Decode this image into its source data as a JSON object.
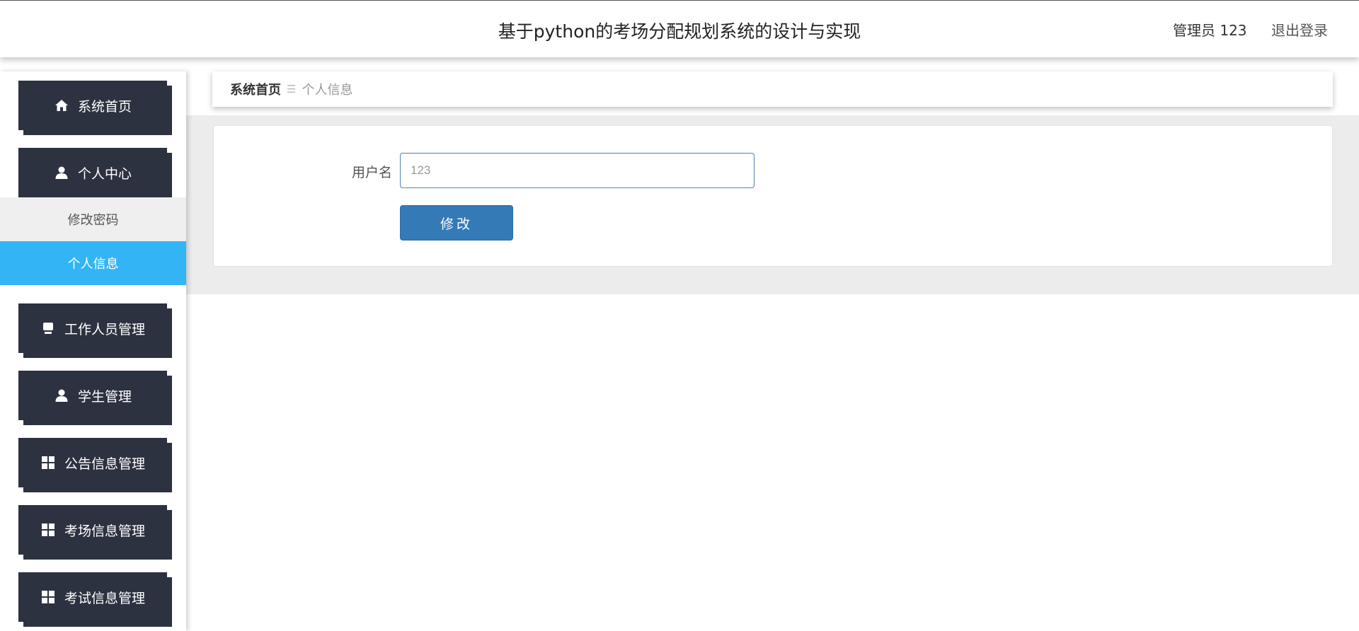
{
  "header": {
    "title": "基于python的考场分配规划系统的设计与实现",
    "user": "管理员 123",
    "logout": "退出登录"
  },
  "sidebar": {
    "home": {
      "label": "系统首页",
      "icon": "home-icon"
    },
    "personal_center": {
      "label": "个人中心",
      "icon": "user-icon"
    },
    "sub_items": [
      {
        "label": "修改密码"
      },
      {
        "label": "个人信息"
      }
    ],
    "menus": [
      {
        "label": "工作人员管理",
        "icon": "tray-icon"
      },
      {
        "label": "学生管理",
        "icon": "user-icon"
      },
      {
        "label": "公告信息管理",
        "icon": "grid-icon"
      },
      {
        "label": "考场信息管理",
        "icon": "grid-icon"
      },
      {
        "label": "考试信息管理",
        "icon": "grid-icon"
      }
    ]
  },
  "breadcrumb": {
    "home": "系统首页",
    "separator": "☰",
    "current": "个人信息"
  },
  "form": {
    "username_label": "用户名",
    "username_placeholder": "123",
    "submit_label": "修改"
  },
  "colors": {
    "menu_bg": "#2c3240",
    "active_sub": "#33b5f5",
    "primary_button": "#337ab7"
  }
}
